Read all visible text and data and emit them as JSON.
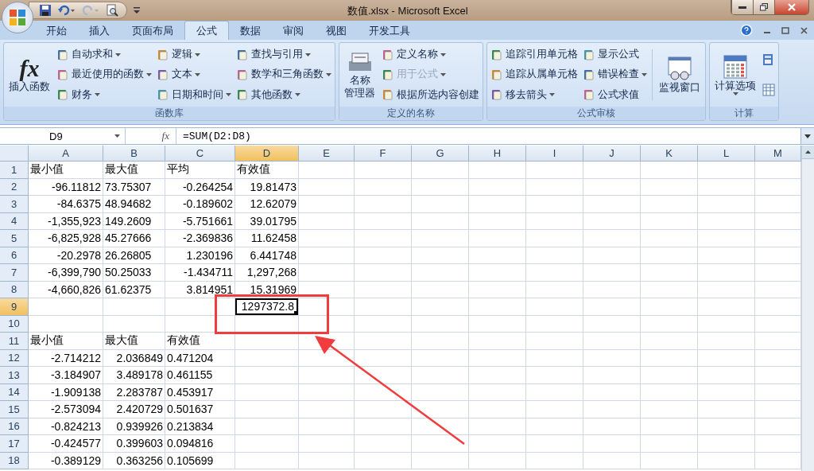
{
  "window": {
    "title": "数值.xlsx - Microsoft Excel"
  },
  "tabs": [
    {
      "label": "开始",
      "selected": false
    },
    {
      "label": "插入",
      "selected": false
    },
    {
      "label": "页面布局",
      "selected": false
    },
    {
      "label": "公式",
      "selected": true
    },
    {
      "label": "数据",
      "selected": false
    },
    {
      "label": "审阅",
      "selected": false
    },
    {
      "label": "视图",
      "selected": false
    },
    {
      "label": "开发工具",
      "selected": false
    }
  ],
  "ribbon": [
    {
      "title": "函数库",
      "big": [
        {
          "glyph": "fx",
          "lines": [
            "插入函数"
          ]
        }
      ],
      "columns": [
        [
          {
            "label": "自动求和",
            "dropdown": true,
            "disabled": false
          },
          {
            "label": "最近使用的函数",
            "dropdown": true,
            "disabled": false
          },
          {
            "label": "财务",
            "dropdown": true,
            "disabled": false
          }
        ],
        [
          {
            "label": "逻辑",
            "dropdown": true,
            "disabled": false
          },
          {
            "label": "文本",
            "dropdown": true,
            "disabled": false
          },
          {
            "label": "日期和时间",
            "dropdown": true,
            "disabled": false
          }
        ],
        [
          {
            "label": "查找与引用",
            "dropdown": true,
            "disabled": false
          },
          {
            "label": "数学和三角函数",
            "dropdown": true,
            "disabled": false
          },
          {
            "label": "其他函数",
            "dropdown": true,
            "disabled": false
          }
        ]
      ]
    },
    {
      "title": "定义的名称",
      "big": [
        {
          "lines": [
            "名称",
            "管理器"
          ]
        }
      ],
      "columns": [
        [
          {
            "label": "定义名称",
            "dropdown": true,
            "disabled": false
          },
          {
            "label": "用于公式",
            "dropdown": true,
            "disabled": true
          },
          {
            "label": "根据所选内容创建",
            "dropdown": false,
            "disabled": false
          }
        ]
      ]
    },
    {
      "title": "公式审核",
      "columns": [
        [
          {
            "label": "追踪引用单元格",
            "dropdown": false,
            "disabled": false
          },
          {
            "label": "追踪从属单元格",
            "dropdown": false,
            "disabled": false
          },
          {
            "label": "移去箭头",
            "dropdown": true,
            "disabled": false
          }
        ],
        [
          {
            "label": "显示公式",
            "dropdown": false,
            "disabled": false
          },
          {
            "label": "错误检查",
            "dropdown": true,
            "disabled": false
          },
          {
            "label": "公式求值",
            "dropdown": false,
            "disabled": false
          }
        ]
      ],
      "big_after": [
        {
          "lines": [
            "监视窗口"
          ]
        }
      ]
    },
    {
      "title": "计算",
      "big": [
        {
          "lines": [
            "计算选项"
          ],
          "dropdown": true
        }
      ],
      "small_icons": true
    }
  ],
  "name_box": "D9",
  "formula_glyph": "fx",
  "formula": "=SUM(D2:D8)",
  "columns": [
    {
      "label": "A",
      "selected": false
    },
    {
      "label": "B",
      "selected": false
    },
    {
      "label": "C",
      "selected": false
    },
    {
      "label": "D",
      "selected": true
    },
    {
      "label": "E",
      "selected": false
    },
    {
      "label": "F",
      "selected": false
    },
    {
      "label": "G",
      "selected": false
    },
    {
      "label": "H",
      "selected": false
    },
    {
      "label": "I",
      "selected": false
    },
    {
      "label": "J",
      "selected": false
    },
    {
      "label": "K",
      "selected": false
    },
    {
      "label": "L",
      "selected": false
    },
    {
      "label": "M",
      "selected": false
    }
  ],
  "rows": [
    {
      "header": "1",
      "selected": false,
      "a": {
        "text": "最小值",
        "kind": "text",
        "selected": false
      },
      "b": {
        "text": "最大值",
        "kind": "text",
        "selected": false
      },
      "c": {
        "text": "平均",
        "kind": "text",
        "selected": false
      },
      "d": {
        "text": "有效值",
        "kind": "text",
        "selected": false
      }
    },
    {
      "header": "2",
      "selected": false,
      "a": {
        "text": "-96.11812",
        "kind": "number",
        "selected": false
      },
      "b": {
        "text": "73.75307",
        "kind": "text",
        "selected": false
      },
      "c": {
        "text": "-0.264254",
        "kind": "number",
        "selected": false
      },
      "d": {
        "text": "19.81473",
        "kind": "number",
        "selected": false
      }
    },
    {
      "header": "3",
      "selected": false,
      "a": {
        "text": "-84.6375",
        "kind": "number",
        "selected": false
      },
      "b": {
        "text": "48.94682",
        "kind": "text",
        "selected": false
      },
      "c": {
        "text": "-0.189602",
        "kind": "number",
        "selected": false
      },
      "d": {
        "text": "12.62079",
        "kind": "number",
        "selected": false
      }
    },
    {
      "header": "4",
      "selected": false,
      "a": {
        "text": "-1,355,923",
        "kind": "number",
        "selected": false
      },
      "b": {
        "text": "149.2609",
        "kind": "text",
        "selected": false
      },
      "c": {
        "text": "-5.751661",
        "kind": "number",
        "selected": false
      },
      "d": {
        "text": "39.01795",
        "kind": "number",
        "selected": false
      }
    },
    {
      "header": "5",
      "selected": false,
      "a": {
        "text": "-6,825,928",
        "kind": "number",
        "selected": false
      },
      "b": {
        "text": "45.27666",
        "kind": "text",
        "selected": false
      },
      "c": {
        "text": "-2.369836",
        "kind": "number",
        "selected": false
      },
      "d": {
        "text": "11.62458",
        "kind": "number",
        "selected": false
      }
    },
    {
      "header": "6",
      "selected": false,
      "a": {
        "text": "-20.2978",
        "kind": "number",
        "selected": false
      },
      "b": {
        "text": "26.26805",
        "kind": "text",
        "selected": false
      },
      "c": {
        "text": "1.230196",
        "kind": "number",
        "selected": false
      },
      "d": {
        "text": "6.441748",
        "kind": "number",
        "selected": false
      }
    },
    {
      "header": "7",
      "selected": false,
      "a": {
        "text": "-6,399,790",
        "kind": "number",
        "selected": false
      },
      "b": {
        "text": "50.25033",
        "kind": "text",
        "selected": false
      },
      "c": {
        "text": "-1.434711",
        "kind": "number",
        "selected": false
      },
      "d": {
        "text": "1,297,268",
        "kind": "number",
        "selected": false
      }
    },
    {
      "header": "8",
      "selected": false,
      "a": {
        "text": "-4,660,826",
        "kind": "number",
        "selected": false
      },
      "b": {
        "text": "61.62375",
        "kind": "text",
        "selected": false
      },
      "c": {
        "text": "3.814951",
        "kind": "number",
        "selected": false
      },
      "d": {
        "text": "15.31969",
        "kind": "number",
        "selected": false
      }
    },
    {
      "header": "9",
      "selected": true,
      "d": {
        "text": "1297372.8",
        "kind": "number",
        "selected": true
      }
    },
    {
      "header": "10",
      "selected": false
    },
    {
      "header": "11",
      "selected": false,
      "a": {
        "text": "最小值",
        "kind": "text",
        "selected": false
      },
      "b": {
        "text": "最大值",
        "kind": "text",
        "selected": false
      },
      "c": {
        "text": "有效值",
        "kind": "text",
        "selected": false
      }
    },
    {
      "header": "12",
      "selected": false,
      "a": {
        "text": "-2.714212",
        "kind": "number",
        "selected": false
      },
      "b": {
        "text": "2.036849",
        "kind": "number",
        "selected": false
      },
      "c": {
        "text": "0.471204",
        "kind": "text",
        "selected": false
      }
    },
    {
      "header": "13",
      "selected": false,
      "a": {
        "text": "-3.184907",
        "kind": "number",
        "selected": false
      },
      "b": {
        "text": "3.489178",
        "kind": "number",
        "selected": false
      },
      "c": {
        "text": "0.461155",
        "kind": "text",
        "selected": false
      }
    },
    {
      "header": "14",
      "selected": false,
      "a": {
        "text": "-1.909138",
        "kind": "number",
        "selected": false
      },
      "b": {
        "text": "2.283787",
        "kind": "number",
        "selected": false
      },
      "c": {
        "text": "0.453917",
        "kind": "text",
        "selected": false
      }
    },
    {
      "header": "15",
      "selected": false,
      "a": {
        "text": "-2.573094",
        "kind": "number",
        "selected": false
      },
      "b": {
        "text": "2.420729",
        "kind": "number",
        "selected": false
      },
      "c": {
        "text": "0.501637",
        "kind": "text",
        "selected": false
      }
    },
    {
      "header": "16",
      "selected": false,
      "a": {
        "text": "-0.824213",
        "kind": "number",
        "selected": false
      },
      "b": {
        "text": "0.939926",
        "kind": "number",
        "selected": false
      },
      "c": {
        "text": "0.213834",
        "kind": "text",
        "selected": false
      }
    },
    {
      "header": "17",
      "selected": false,
      "a": {
        "text": "-0.424577",
        "kind": "number",
        "selected": false
      },
      "b": {
        "text": "0.399603",
        "kind": "number",
        "selected": false
      },
      "c": {
        "text": "0.094816",
        "kind": "text",
        "selected": false
      }
    },
    {
      "header": "18",
      "selected": false,
      "a": {
        "text": "-0.389129",
        "kind": "number",
        "selected": false
      },
      "b": {
        "text": "0.363256",
        "kind": "number",
        "selected": false
      },
      "c": {
        "text": "0.105699",
        "kind": "text",
        "selected": false
      }
    }
  ]
}
